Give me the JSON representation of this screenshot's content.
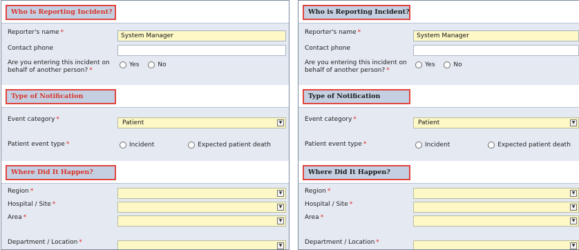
{
  "sections": {
    "reporter": {
      "title": "Who is Reporting Incident?",
      "name_label": "Reporter's name",
      "name_value": "System Manager",
      "phone_label": "Contact phone",
      "phone_value": "",
      "behalf_line1": "Are you entering this incident on",
      "behalf_line2": "behalf of another person?",
      "yes_label": "Yes",
      "no_label": "No"
    },
    "notification": {
      "title": "Type of Notification",
      "category_label": "Event category",
      "category_value": "Patient",
      "patient_type_label": "Patient event type",
      "incident_label": "Incident",
      "expected_death_label": "Expected patient death"
    },
    "location": {
      "title": "Where Did It Happen?",
      "region_label": "Region",
      "hospital_label": "Hospital / Site",
      "area_label": "Area",
      "department_label": "Department / Location"
    }
  },
  "required_marker": "*",
  "dropdown_icon": "chevron-down-icon",
  "colors": {
    "highlight_border": "#e0433c",
    "section_title_bg": "#c4d0e2",
    "form_bg": "#e4e9f2",
    "required": "#e0231f",
    "input_highlight": "#fdf8c6"
  }
}
